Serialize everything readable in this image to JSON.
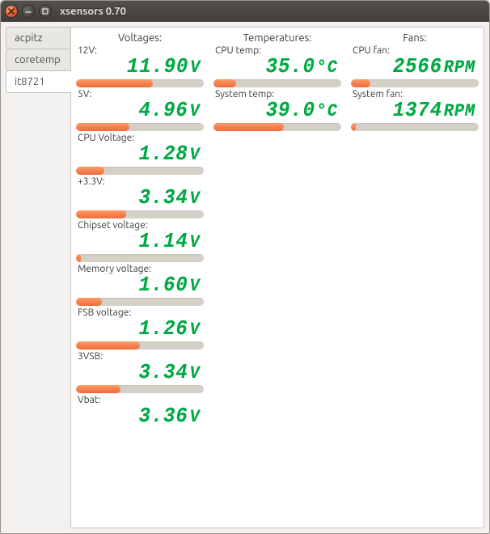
{
  "window": {
    "title": "xsensors 0.70"
  },
  "sidebar": {
    "tabs": [
      {
        "id": "acpitz",
        "label": "acpitz",
        "selected": false
      },
      {
        "id": "coretemp",
        "label": "coretemp",
        "selected": false
      },
      {
        "id": "it8721",
        "label": "it8721",
        "selected": true
      }
    ]
  },
  "headings": {
    "voltages": "Voltages:",
    "temperatures": "Temperatures:",
    "fans": "Fans:"
  },
  "voltages": [
    {
      "label": "12V:",
      "value": "11.90",
      "unit": "V",
      "bar_pct": 60
    },
    {
      "label": "5V:",
      "value": "4.96",
      "unit": "V",
      "bar_pct": 42
    },
    {
      "label": "CPU Voltage:",
      "value": "1.28",
      "unit": "V",
      "bar_pct": 22
    },
    {
      "label": "+3.3V:",
      "value": "3.34",
      "unit": "V",
      "bar_pct": 39
    },
    {
      "label": "Chipset voltage:",
      "value": "1.14",
      "unit": "V",
      "bar_pct": 4
    },
    {
      "label": "Memory voltage:",
      "value": "1.60",
      "unit": "V",
      "bar_pct": 20
    },
    {
      "label": "FSB voltage:",
      "value": "1.26",
      "unit": "V",
      "bar_pct": 50
    },
    {
      "label": "3VSB:",
      "value": "3.34",
      "unit": "V",
      "bar_pct": 35
    },
    {
      "label": "Vbat:",
      "value": "3.36",
      "unit": "V",
      "bar_pct": 0
    }
  ],
  "temperatures": [
    {
      "label": "CPU temp:",
      "value": "35.0",
      "unit": "°C",
      "bar_pct": 18
    },
    {
      "label": "System temp:",
      "value": "39.0",
      "unit": "°C",
      "bar_pct": 55
    }
  ],
  "fans": [
    {
      "label": "CPU fan:",
      "value": "2566",
      "unit": "RPM",
      "bar_pct": 15
    },
    {
      "label": "System fan:",
      "value": "1374",
      "unit": "RPM",
      "bar_pct": 4
    }
  ]
}
